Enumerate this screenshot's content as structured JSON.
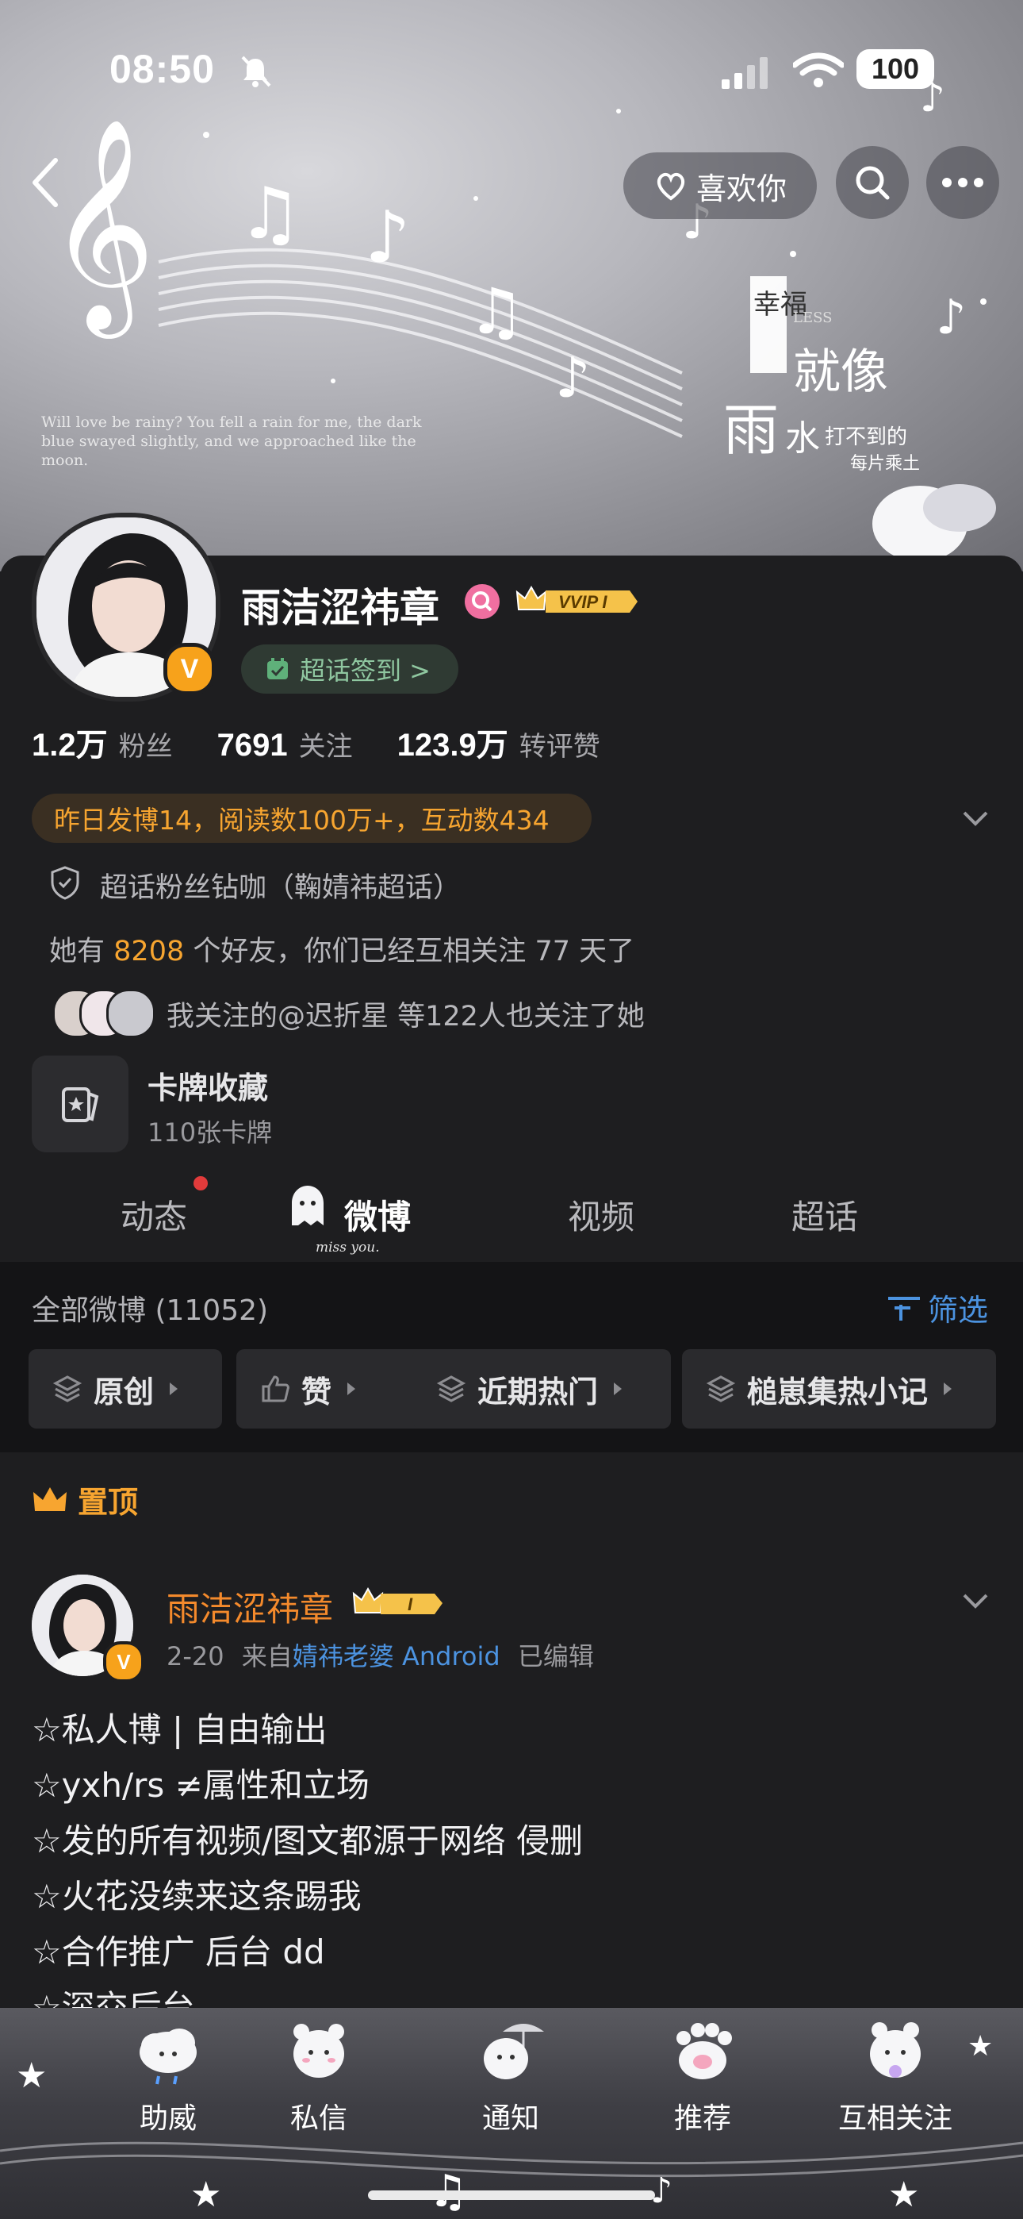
{
  "status_bar": {
    "time": "08:50",
    "battery": "100"
  },
  "header": {
    "like_label": "喜欢你",
    "banner_english": "Will love be rainy? You fell a rain for me, the dark blue swayed slightly, and we approached like the moon.",
    "banner_cn": [
      "幸福",
      "就像",
      "雨",
      "水",
      "打不到的",
      "每片乘土",
      "LESS"
    ]
  },
  "profile": {
    "name": "雨洁涩祎章",
    "vvip": "VVIP I",
    "checkin_label": "超话签到 >",
    "stats": [
      {
        "value": "1.2万",
        "label": "粉丝"
      },
      {
        "value": "7691",
        "label": "关注"
      },
      {
        "value": "123.9万",
        "label": "转评赞"
      }
    ],
    "highlight": "昨日发博14，阅读数100万+，互动数434",
    "supertopic": "超话粉丝钻咖（鞠婧祎超话）",
    "friends_prefix": "她有",
    "friends_count": "8208",
    "friends_suffix": "个好友，你们已经互相关注 77 天了",
    "mutual_follow": "我关注的@迟折星 等122人也关注了她",
    "card_title": "卡牌收藏",
    "card_subtitle": "110张卡牌"
  },
  "tabs": [
    {
      "label": "动态"
    },
    {
      "label": "微博"
    },
    {
      "label": "视频"
    },
    {
      "label": "超话"
    }
  ],
  "tab_deco": "miss you.",
  "filter": {
    "all_count": "全部微博 (11052)",
    "filter_label": "筛选",
    "chips": [
      "原创",
      "赞",
      "近期热门",
      "槌崽集热小记"
    ]
  },
  "pinned_label": "置顶",
  "post": {
    "author": "雨洁涩祎章",
    "crown": "I",
    "date": "2-20",
    "from_prefix": "来自",
    "source": "婧祎老婆 Android",
    "edited": "已编辑",
    "lines": [
      "☆私人博 | 自由输出",
      "☆yxh/rs ≠属性和立场",
      "☆发的所有视频/图文都源于网络 侵删",
      "☆火花没续来这条踢我",
      "☆合作推广 后台 dd",
      "☆深交后台"
    ]
  },
  "bottom_bar": [
    "助威",
    "私信",
    "通知",
    "推荐",
    "互相关注"
  ],
  "colors": {
    "accent_orange": "#f7a530",
    "link_blue": "#4c93e0",
    "background": "#1e1e20"
  }
}
